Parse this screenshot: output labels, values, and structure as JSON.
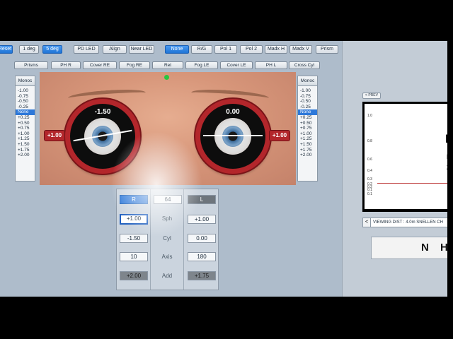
{
  "toolbar1": [
    {
      "label": "Reset",
      "active": true
    },
    {
      "label": "1 deg",
      "active": false
    },
    {
      "label": "5 deg",
      "active": true
    },
    {
      "label": "PD LED",
      "active": false
    },
    {
      "label": "Align",
      "active": false
    },
    {
      "label": "Near LED",
      "active": false
    },
    {
      "label": "None",
      "active": true
    },
    {
      "label": "R/G",
      "active": false
    },
    {
      "label": "Pol 1",
      "active": false
    },
    {
      "label": "Pol 2",
      "active": false
    },
    {
      "label": "Madx H",
      "active": false
    },
    {
      "label": "Madx V",
      "active": false
    },
    {
      "label": "Prism",
      "active": false
    }
  ],
  "toolbar2": [
    "Prisms",
    "PH R",
    "Cover RE",
    "Fog RE",
    "Ret",
    "Fog LE",
    "Cover LE",
    "PH L",
    "Cross Cyl"
  ],
  "left_panel": {
    "header": "Monoc",
    "items": [
      "-1.00",
      "-0.75",
      "-0.50",
      "-0.25",
      "None",
      "+0.25",
      "+0.50",
      "+0.75",
      "+1.00",
      "+1.25",
      "+1.50",
      "+1.75",
      "+2.00"
    ],
    "selected": "None"
  },
  "right_side_panel": {
    "header": "Monoc",
    "items": [
      "-1.00",
      "-0.75",
      "-0.50",
      "-0.25",
      "None",
      "+0.25",
      "+0.50",
      "+0.75",
      "+1.00",
      "+1.25",
      "+1.50",
      "+1.75",
      "+2.00"
    ],
    "selected": "None"
  },
  "lenses": {
    "right": {
      "cyl": "-1.50",
      "sph": "+1.00"
    },
    "left": {
      "cyl": "0.00",
      "sph": "+1.00"
    }
  },
  "rx": {
    "right_header": "R",
    "pd": "64",
    "left_header": "L",
    "labels": [
      "Sph",
      "Cyl",
      "Axis",
      "Add"
    ],
    "right": {
      "sph": "+1.00",
      "cyl": "-1.50",
      "axis": "10",
      "add": "+2.00"
    },
    "left": {
      "sph": "+1.00",
      "cyl": "0.00",
      "axis": "180",
      "add": "+1.75"
    }
  },
  "chart_panel": {
    "prev_label": "< PREV",
    "ticks": [
      "1.0",
      "0.8",
      "0.6",
      "0.4",
      "0.3",
      "0.2",
      "0.2",
      "0.1",
      "0.1"
    ],
    "viewing": "VIEWING DIST : 4.0m   SNELLEN CH",
    "back_label": "<",
    "near_letters": "N H"
  }
}
